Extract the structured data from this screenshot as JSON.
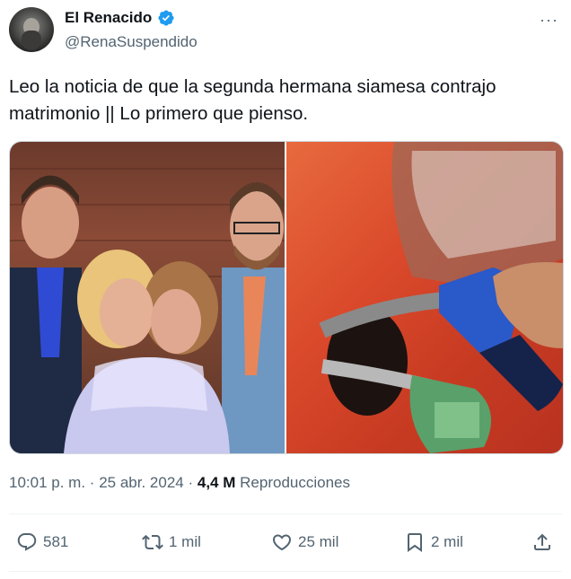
{
  "author": {
    "display_name": "El Renacido",
    "handle": "@RenaSuspendido",
    "verified_color": "#1d9bf0"
  },
  "more_label": "···",
  "tweet": {
    "text_line1": "Leo la noticia de que la segunda hermana siamesa contrajo",
    "text_line2": "matrimonio || Lo primero que pienso."
  },
  "meta": {
    "time": "10:01 p. m.",
    "separator": "·",
    "date": "25 abr. 2024",
    "views_count": "4,4 M",
    "views_label": "Reproducciones"
  },
  "actions": {
    "replies": "581",
    "reposts": "1 mil",
    "likes": "25 mil",
    "bookmarks": "2 mil"
  },
  "icons": [
    "reply-icon",
    "repost-icon",
    "like-icon",
    "bookmark-icon",
    "share-icon",
    "verified-badge-icon",
    "more-icon"
  ]
}
